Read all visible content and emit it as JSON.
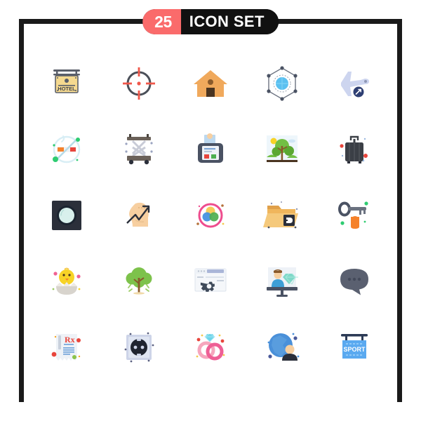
{
  "header": {
    "count": "25",
    "label": "ICON SET",
    "count_bg": "#fa6b6b",
    "label_bg": "#111111",
    "frame_color": "#1a1a1a"
  },
  "grid": {
    "columns": 5,
    "rows": 5,
    "total": 25
  },
  "icons": [
    {
      "id": "hotel-sign",
      "name": "Hotel Sign",
      "label": "HOTEL",
      "color": "#f5d98f"
    },
    {
      "id": "crosshair-target",
      "name": "Crosshair Target",
      "label": "",
      "color": "#f0574a"
    },
    {
      "id": "house-home",
      "name": "House",
      "label": "",
      "color": "#f0a95c"
    },
    {
      "id": "global-network",
      "name": "Global Network",
      "label": "",
      "color": "#5bc0f0"
    },
    {
      "id": "airplane-flight",
      "name": "Airplane Flight",
      "label": "",
      "color": "#cdd5ef"
    },
    {
      "id": "no-smoking",
      "name": "No Smoking",
      "label": "",
      "color": "#2ecc71"
    },
    {
      "id": "scissor-lift",
      "name": "Scissor Lift",
      "label": "",
      "color": "#6b6159"
    },
    {
      "id": "card-terminal",
      "name": "Payment Terminal",
      "label": "",
      "color": "#4a5263"
    },
    {
      "id": "park-nature",
      "name": "Park Nature Scene",
      "label": "",
      "color": "#72bf44"
    },
    {
      "id": "suitcase-luggage",
      "name": "Suitcase Luggage",
      "label": "",
      "color": "#3b3f46"
    },
    {
      "id": "moon-night",
      "name": "Moon Night",
      "label": "",
      "color": "#2b2f3a"
    },
    {
      "id": "mind-growth",
      "name": "Mind Growth Chart",
      "label": "",
      "color": "#f7cfa0"
    },
    {
      "id": "color-wheel",
      "name": "Color Wheel",
      "label": "",
      "color": "#ee4d8e"
    },
    {
      "id": "folder-3d",
      "name": "Folder with 3D Cube",
      "label": "",
      "color": "#f0b65c"
    },
    {
      "id": "key-tag",
      "name": "Key with Tag",
      "label": "",
      "color": "#f5822b"
    },
    {
      "id": "hatching-chick",
      "name": "Hatching Chick",
      "label": "",
      "color": "#f7d327"
    },
    {
      "id": "tree",
      "name": "Tree",
      "label": "",
      "color": "#7dc24b"
    },
    {
      "id": "browser-settings",
      "name": "Browser Settings",
      "label": "",
      "color": "#3f4a5a"
    },
    {
      "id": "presenter-diamond",
      "name": "Presenter with Diamond",
      "label": "",
      "color": "#3e9fd6"
    },
    {
      "id": "chat-bubble",
      "name": "Chat Bubble Typing",
      "label": "",
      "color": "#5a6070"
    },
    {
      "id": "prescription-rx",
      "name": "Prescription Rx",
      "label": "Rx",
      "color": "#e8453c"
    },
    {
      "id": "power-socket",
      "name": "Power Socket",
      "label": "",
      "color": "#cdd4e8"
    },
    {
      "id": "wedding-rings",
      "name": "Wedding Rings",
      "label": "",
      "color": "#f6a6bd"
    },
    {
      "id": "global-user",
      "name": "Global User",
      "label": "",
      "color": "#4a90d9"
    },
    {
      "id": "sport-sign",
      "name": "Sport Sign",
      "label": "SPORT",
      "color": "#5aa9f0"
    }
  ]
}
